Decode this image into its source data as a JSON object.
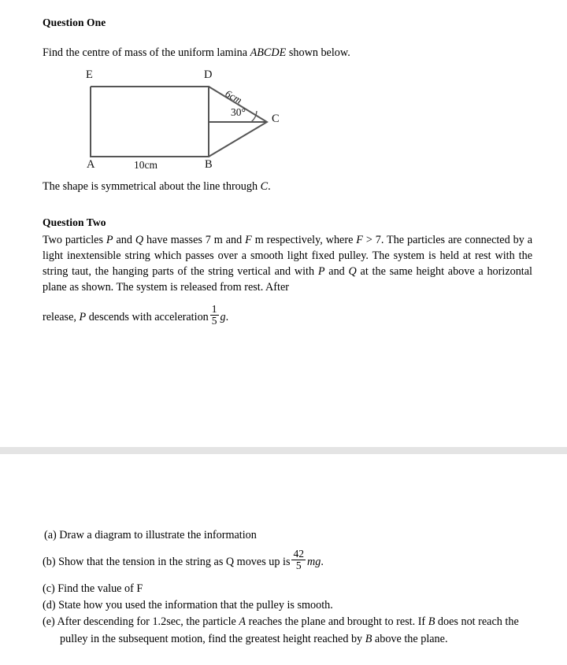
{
  "document": {
    "background_color": "#ffffff",
    "text_color": "#000000",
    "separator_color": "#e4e4e4",
    "diagram_line_color": "#555555"
  },
  "question_one": {
    "heading": "Question One",
    "prompt_before": "Find the centre of mass of the uniform lamina ",
    "prompt_italic": "ABCDE",
    "prompt_after": " shown below.",
    "note_before": "The shape is symmetrical about the line through ",
    "note_italic": "C",
    "note_after": "."
  },
  "diagram": {
    "name": "lamina-abcde",
    "vertices": {
      "E": "E",
      "D": "D",
      "A": "A",
      "B": "B",
      "C": "C"
    },
    "base_length_label": "10cm",
    "slant_length_label": "6cm",
    "angle_label": "30°"
  },
  "question_two": {
    "heading": "Question Two",
    "body": {
      "seg1": "Two particles ",
      "p1": "P",
      "seg2": " and ",
      "q1": "Q",
      "seg3": " have masses 7 m and ",
      "f1": "F",
      "seg4": " m respectively, where   ",
      "f2": "F",
      "seg5": " > 7. The particles are connected by a light inextensible string which passes over a smooth light fixed pulley. The system is held at rest with the string taut, the hanging parts of the string vertical and with ",
      "p2": "P",
      "seg6": " and ",
      "q2": "Q",
      "seg7": " at the same height above a horizontal plane as shown. The system is released from rest. After"
    },
    "release_line": {
      "seg1": "release, ",
      "p": "P",
      "seg2": " descends with acceleration",
      "frac_num": "1",
      "frac_den": "5",
      "g": "g",
      "seg3": "."
    },
    "parts": [
      {
        "marker": "(a)",
        "text": "Draw a diagram to illustrate the information"
      },
      {
        "marker": "(b)",
        "text_before": "Show that the tension in the string as Q moves up is",
        "frac_num": "42",
        "frac_den": "5",
        "mg": "mg",
        "text_after": "."
      },
      {
        "marker": "(c)",
        "text": "Find the value of F"
      },
      {
        "marker": "(d)",
        "text": "State how you used the information that the pulley is smooth."
      },
      {
        "marker": "(e)",
        "seg1": "After descending for 1.2sec, the particle ",
        "a1": "A",
        "seg2": " reaches the plane and brought to rest. If ",
        "b1": "B",
        "seg3": " does not reach the pulley in the subsequent motion, find the greatest height reached by ",
        "b2": "B",
        "seg4": " above the plane."
      }
    ]
  }
}
